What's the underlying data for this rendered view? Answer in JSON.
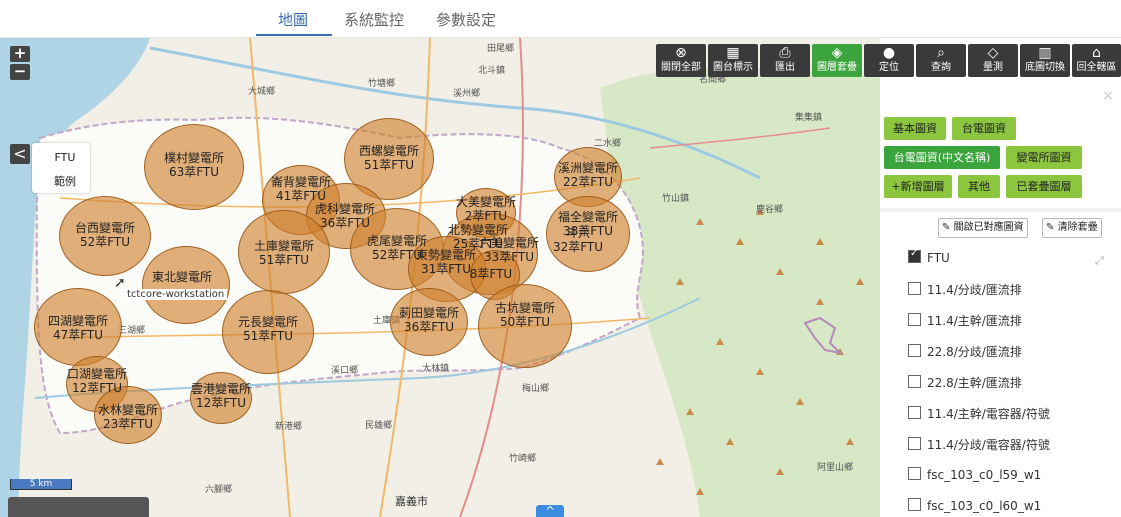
{
  "tabs": [
    {
      "label": "地圖",
      "active": true
    },
    {
      "label": "系統監控",
      "active": false
    },
    {
      "label": "參數設定",
      "active": false
    }
  ],
  "zoom": {
    "in": "+",
    "out": "−"
  },
  "legend": {
    "toggle": "<",
    "items": [
      "FTU",
      "範例"
    ]
  },
  "toolbar": [
    {
      "label": "關閉全部",
      "icon": "close-circle-icon",
      "glyph": "⊗"
    },
    {
      "label": "圖台標示",
      "icon": "map-icon",
      "glyph": "▦"
    },
    {
      "label": "匯出",
      "icon": "printer-icon",
      "glyph": "⎙"
    },
    {
      "label": "圖層套疊",
      "icon": "layers-icon",
      "glyph": "◈",
      "active": true
    },
    {
      "label": "定位",
      "icon": "location-pin-icon",
      "glyph": "●"
    },
    {
      "label": "查詢",
      "icon": "search-icon",
      "glyph": "⌕"
    },
    {
      "label": "量測",
      "icon": "ruler-icon",
      "glyph": "◇"
    },
    {
      "label": "底圖切換",
      "icon": "basemap-switch-icon",
      "glyph": "▥"
    },
    {
      "label": "回全轄區",
      "icon": "home-extent-icon",
      "glyph": "⌂"
    }
  ],
  "panel": {
    "close": "×",
    "buttons_row1": [
      "基本圖資",
      "台電圖資"
    ],
    "buttons_row2": [
      "台電圖資(中文名稱)",
      "變電所圖資"
    ],
    "buttons_row3": [
      "+新增圖層",
      "其他",
      "已套疊圖層"
    ],
    "action_buttons": [
      "關啟已對應圖資",
      "清除套疊"
    ],
    "layers": [
      {
        "label": "FTU",
        "checked": true
      },
      {
        "label": "11.4/分歧/匯流排",
        "checked": false
      },
      {
        "label": "11.4/主幹/匯流排",
        "checked": false
      },
      {
        "label": "22.8/分歧/匯流排",
        "checked": false
      },
      {
        "label": "22.8/主幹/匯流排",
        "checked": false
      },
      {
        "label": "11.4/主幹/電容器/符號",
        "checked": false
      },
      {
        "label": "11.4/分歧/電容器/符號",
        "checked": false
      },
      {
        "label": "fsc_103_c0_l59_w1",
        "checked": false
      },
      {
        "label": "fsc_103_c0_l60_w1",
        "checked": false
      }
    ]
  },
  "map": {
    "substations": [
      {
        "name": "樸村變電所",
        "count": "63萃FTU"
      },
      {
        "name": "西螺變電所",
        "count": "51萃FTU"
      },
      {
        "name": "崙背變電所",
        "count": "41萃FTU"
      },
      {
        "name": "虎科變電所",
        "count": "36萃FTU"
      },
      {
        "name": "台西變電所",
        "count": "52萃FTU"
      },
      {
        "name": "土庫變電所",
        "count": "51萃FTU"
      },
      {
        "name": "虎尾變電所",
        "count": "52萃FTU"
      },
      {
        "name": "大美變電所",
        "count": "2萃FTU"
      },
      {
        "name": "北勢變電所",
        "count": "25萃FTU"
      },
      {
        "name": "六美變電所",
        "count": "33萃FTU"
      },
      {
        "name": "東勢變電所",
        "count": "31萃FTU"
      },
      {
        "name": "8萃FTU",
        "count": ""
      },
      {
        "name": "溪洲變電所",
        "count": "22萃FTU"
      },
      {
        "name": "福全變電所",
        "count": "38萃FTU"
      },
      {
        "name": "斗六",
        "count": "32萃FTU"
      },
      {
        "name": "東北變電所",
        "count": ""
      },
      {
        "name": "四湖變電所",
        "count": "47萃FTU"
      },
      {
        "name": "元長變電所",
        "count": "51萃FTU"
      },
      {
        "name": "莿田變電所",
        "count": "36萃FTU"
      },
      {
        "name": "古坑變電所",
        "count": "50萃FTU"
      },
      {
        "name": "口湖變電所",
        "count": "12萃FTU"
      },
      {
        "name": "水林變電所",
        "count": "23萃FTU"
      },
      {
        "name": "雲港變電所",
        "count": "12萃FTU"
      }
    ],
    "places": [
      "田尾鄉",
      "竹塘鄉",
      "北斗鎮",
      "溪州鄉",
      "大城鄉",
      "名間鄉",
      "集集鎮",
      "二水鄉",
      "竹山鎮",
      "鹿谷鄉",
      "梅山鄉",
      "竹崎鄉",
      "大林鎮",
      "溪口鄉",
      "新港鄉",
      "民雄鄉",
      "六腳鄉",
      "嘉義市",
      "阿里山鄉",
      "土庫鎮",
      "三湖鄉"
    ],
    "tooltip": "tctcore-workstation",
    "scale": "5 km",
    "bottom_toggle": "^"
  }
}
